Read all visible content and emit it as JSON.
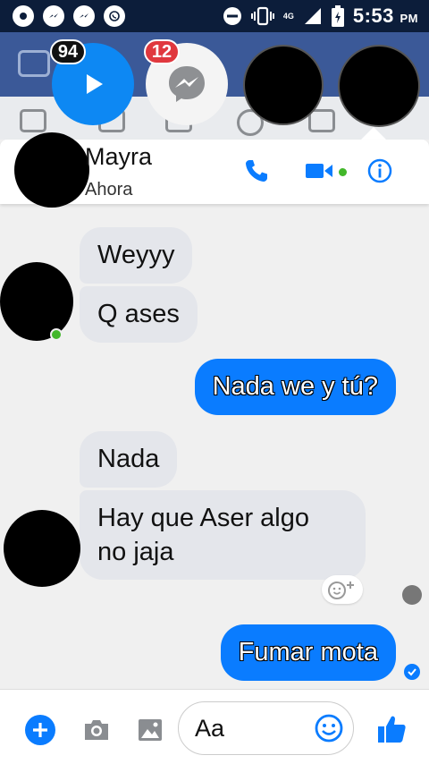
{
  "status_bar": {
    "time": "5:53",
    "ampm": "PM",
    "network": "4G",
    "icons": [
      "record-icon",
      "messenger-icon",
      "messenger-icon",
      "whatsapp-icon",
      "dnd-icon",
      "vibrate-icon",
      "signal-icon",
      "battery-icon"
    ]
  },
  "chat_heads": {
    "video_badge": "94",
    "messenger_badge": "12"
  },
  "conversation": {
    "contact_name": "Mayra",
    "contact_status": "Ahora"
  },
  "messages": [
    {
      "direction": "incoming",
      "text": "Weyyy"
    },
    {
      "direction": "incoming",
      "text": "Q ases"
    },
    {
      "direction": "outgoing",
      "text": "Nada we y tú?"
    },
    {
      "direction": "incoming",
      "text": "Nada"
    },
    {
      "direction": "incoming",
      "text": "Hay que Aser algo",
      "text2": "no jaja"
    },
    {
      "direction": "outgoing",
      "text": "Fumar mota"
    }
  ],
  "composer": {
    "placeholder": "Aa"
  },
  "colors": {
    "accent": "#0a7cff",
    "online": "#42b72a",
    "badge_red": "#e0383e"
  }
}
